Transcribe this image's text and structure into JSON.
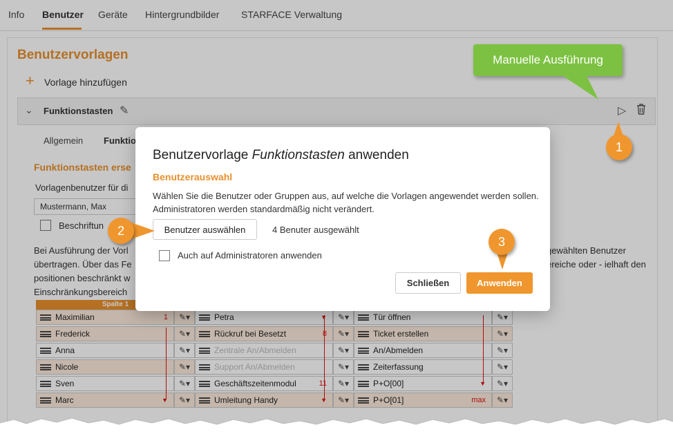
{
  "top_tabs": [
    "Info",
    "Benutzer",
    "Geräte",
    "Hintergrundbilder",
    "STARFACE Verwaltung"
  ],
  "page": {
    "title": "Benutzervorlagen",
    "add_template": "Vorlage hinzufügen",
    "template_name": "Funktionstasten",
    "subtabs": [
      "Allgemein",
      "Funktio"
    ],
    "section_title": "Funktionstasten erse",
    "field_label": "Vorlagenbenutzer für di",
    "select_value": "Mustermann, Max",
    "checkbox_label": "Beschriftun",
    "para_left": "Bei Ausführung der Vorl übertragen. Über das Fe positionen beschränkt w Einschränkungsbereich",
    "para_right": "gewählten Benutzer ereiche oder - ielhaft den"
  },
  "grid": {
    "header": "Spalte 1",
    "col1": [
      {
        "name": "Maximilian",
        "mark": "1"
      },
      {
        "name": "Frederick",
        "mark": ""
      },
      {
        "name": "Anna",
        "mark": ""
      },
      {
        "name": "Nicole",
        "mark": ""
      },
      {
        "name": "Sven",
        "mark": ""
      },
      {
        "name": "Marc",
        "mark": ""
      }
    ],
    "col2": [
      {
        "name": "Petra",
        "mark": ""
      },
      {
        "name": "Rückruf bei Besetzt",
        "mark": "8"
      },
      {
        "name": "Zentrale An/Abmelden",
        "mark": ""
      },
      {
        "name": "Support An/Abmelden",
        "mark": ""
      },
      {
        "name": "Geschäftszeitenmodul",
        "mark": "11"
      },
      {
        "name": "Umleitung Handy",
        "mark": ""
      }
    ],
    "col3": [
      {
        "name": "Tür öffnen",
        "mark": ""
      },
      {
        "name": "Ticket erstellen",
        "mark": ""
      },
      {
        "name": "An/Abmelden",
        "mark": ""
      },
      {
        "name": "Zeiterfassung",
        "mark": ""
      },
      {
        "name": "P+O[00]",
        "mark": ""
      },
      {
        "name": "P+O[01]",
        "mark": "max"
      }
    ]
  },
  "dialog": {
    "title_prefix": "Benutzervorlage ",
    "title_em": "Funktionstasten",
    "title_suffix": " anwenden",
    "subtitle": "Benutzerauswahl",
    "description": "Wählen Sie die Benutzer oder Gruppen aus, auf welche die Vorlagen angewendet werden sollen. Administratoren werden standardmäßig nicht verändert.",
    "select_button": "Benutzer auswählen",
    "selected_count": "4 Benuter ausgewählt",
    "admin_checkbox": "Auch auf Administratoren anwenden",
    "close_button": "Schließen",
    "apply_button": "Anwenden"
  },
  "callouts": {
    "tooltip": "Manuelle Ausführung",
    "badge1": "1",
    "badge2": "2",
    "badge3": "3"
  },
  "colors": {
    "accent": "#e8902e",
    "button_orange": "#f0962e",
    "tooltip_green": "#7dc142",
    "alert_red": "#dd1111"
  }
}
